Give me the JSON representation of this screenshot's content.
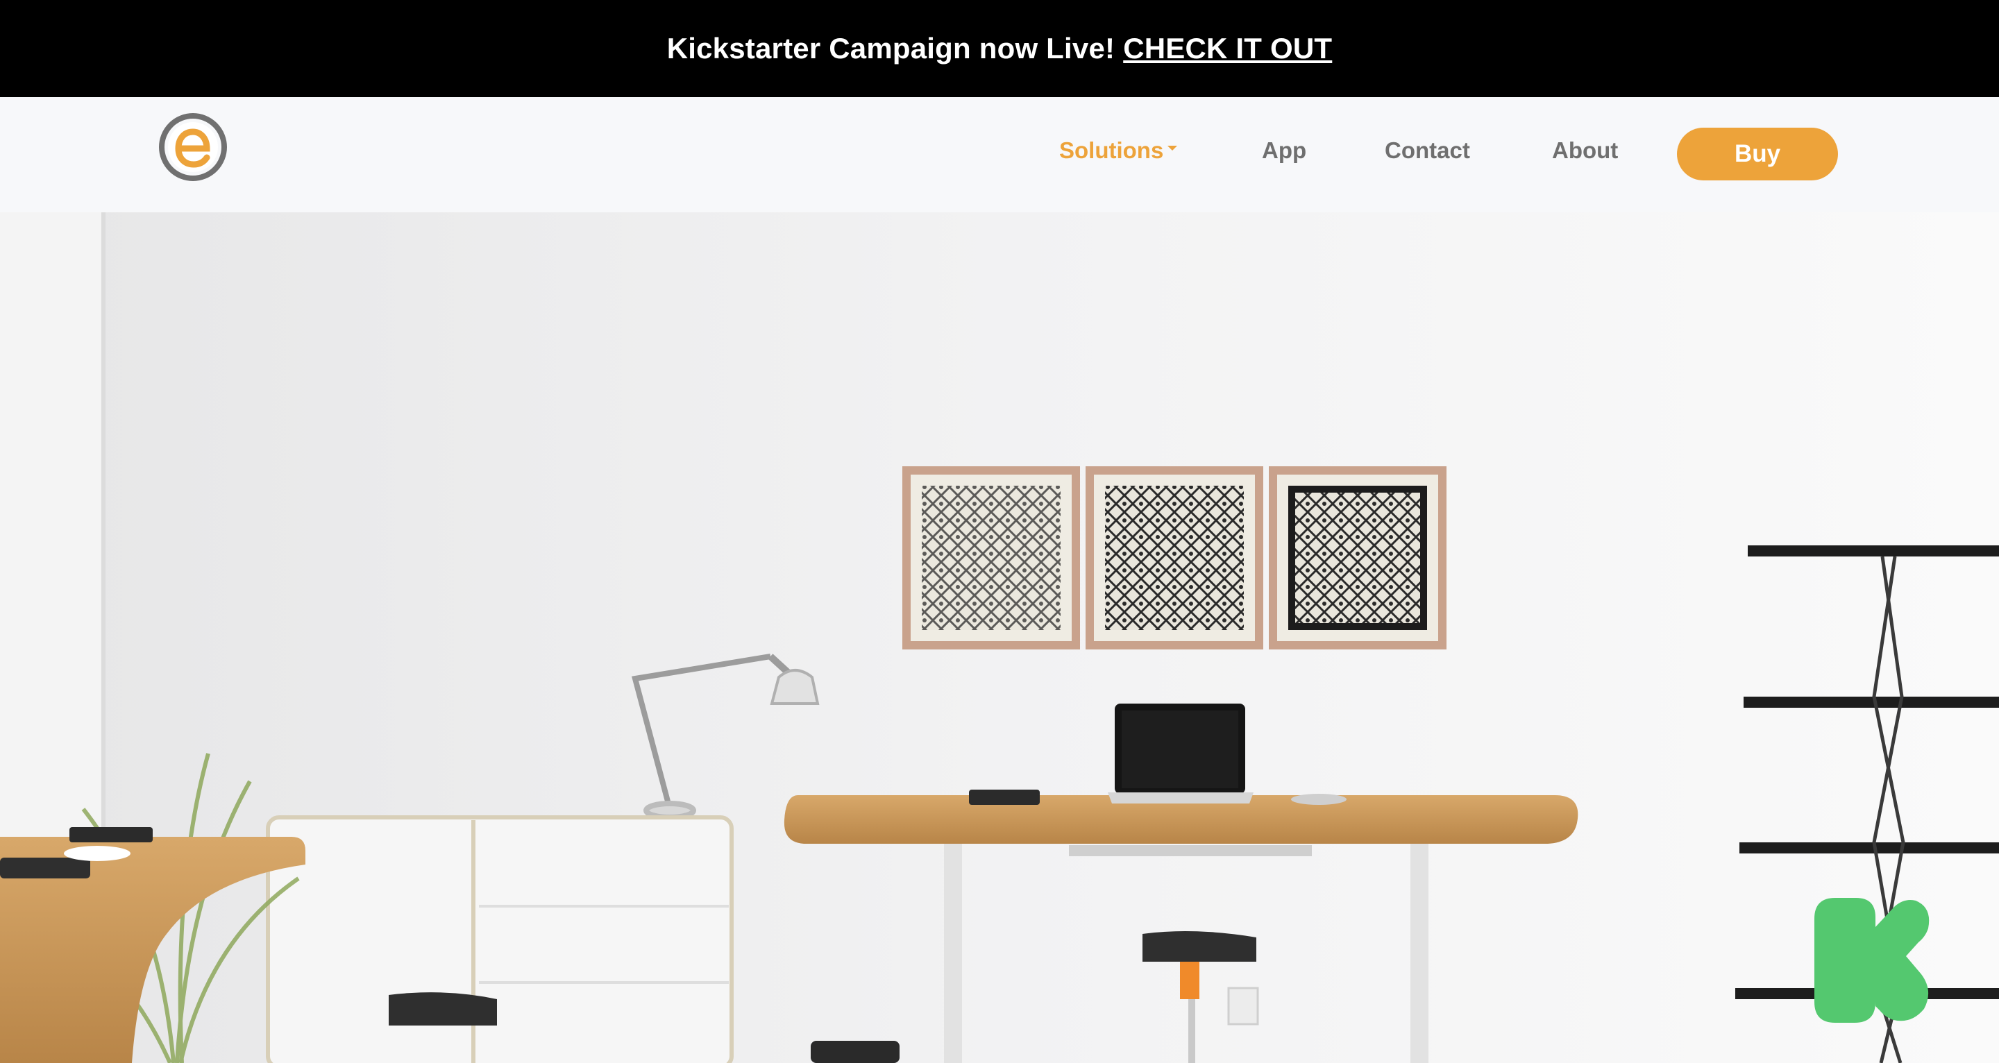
{
  "announcement": {
    "text": "Kickstarter Campaign now Live!",
    "link_label": "CHECK IT OUT"
  },
  "nav": {
    "logo_letter": "e",
    "items": [
      {
        "label": "Solutions",
        "active": true,
        "has_dropdown": true
      },
      {
        "label": "App"
      },
      {
        "label": "Contact"
      },
      {
        "label": "About"
      }
    ],
    "buy_label": "Buy"
  },
  "hero": {
    "scene": "office-desk-illustration",
    "icons": [
      "desk-lamp-icon",
      "laptop-icon",
      "plant-icon",
      "shelf-icon",
      "wall-art-icon"
    ]
  },
  "kickstarter_badge": {
    "icon": "kickstarter-k-icon",
    "color": "#54c86f"
  },
  "colors": {
    "accent": "#eda33a",
    "nav_text": "#6f6f6f",
    "banner_bg": "#000000",
    "navbar_bg": "#f7f8fa"
  }
}
